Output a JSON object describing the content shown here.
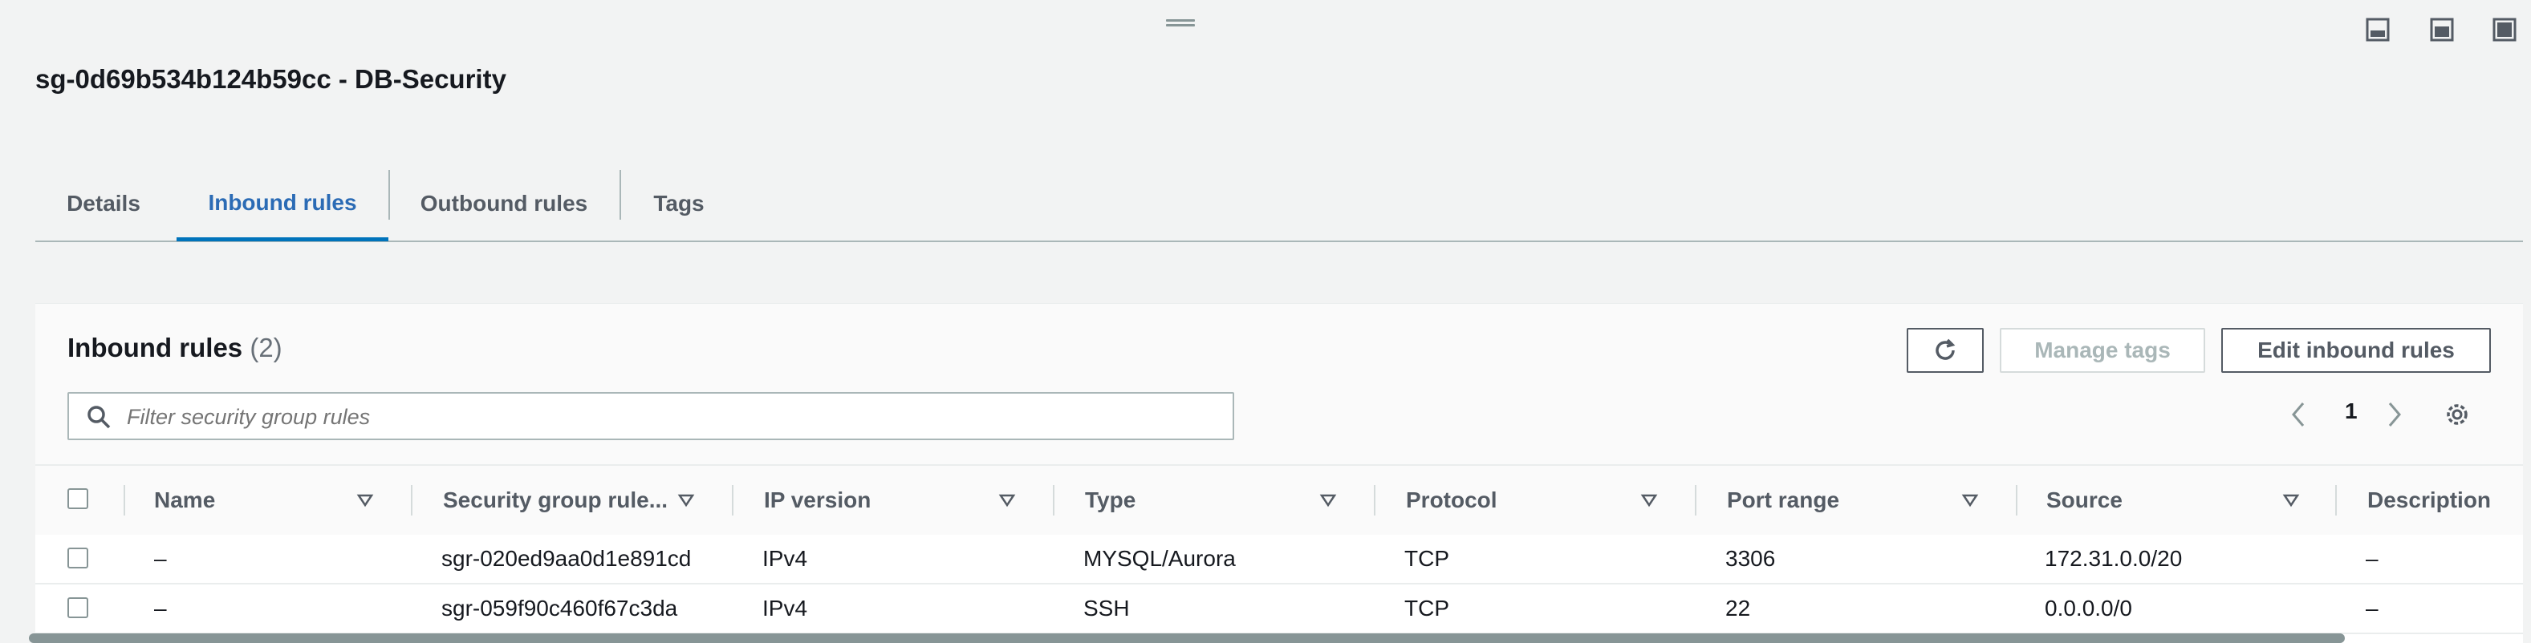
{
  "window": {
    "title": "sg-0d69b534b124b59cc - DB-Security"
  },
  "layout_buttons": [
    {
      "icon": "panel-bottom-icon"
    },
    {
      "icon": "panel-middle-icon"
    },
    {
      "icon": "panel-full-icon"
    }
  ],
  "tabs": [
    {
      "label": "Details",
      "active": false
    },
    {
      "label": "Inbound rules",
      "active": true
    },
    {
      "label": "Outbound rules",
      "active": false
    },
    {
      "label": "Tags",
      "active": false
    }
  ],
  "card": {
    "title": "Inbound rules",
    "count": "(2)",
    "refresh_icon": "refresh-icon",
    "manage_tags_label": "Manage tags",
    "edit_label": "Edit inbound rules",
    "search_placeholder": "Filter security group rules",
    "page_number": "1"
  },
  "table": {
    "columns": [
      "Name",
      "Security group rule...",
      "IP version",
      "Type",
      "Protocol",
      "Port range",
      "Source",
      "Description"
    ],
    "rows": [
      [
        "–",
        "sgr-020ed9aa0d1e891cd",
        "IPv4",
        "MYSQL/Aurora",
        "TCP",
        "3306",
        "172.31.0.0/20",
        "–"
      ],
      [
        "–",
        "sgr-059f90c460f67c3da",
        "IPv4",
        "SSH",
        "TCP",
        "22",
        "0.0.0.0/0",
        "–"
      ]
    ]
  },
  "colors": {
    "accent": "#2b6bb5",
    "border": "#aab7b8",
    "text": "#16191f"
  }
}
